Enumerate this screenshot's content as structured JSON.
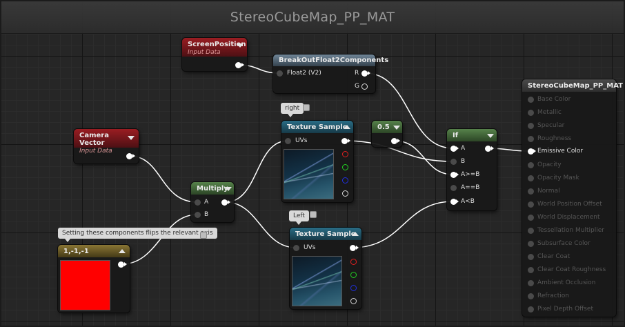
{
  "window": {
    "title": "StereoCubeMap_PP_MAT"
  },
  "nodes": {
    "screen_position": {
      "title": "ScreenPosition",
      "subtitle": "Input Data"
    },
    "camera_vector": {
      "title": "Camera Vector",
      "subtitle": "Input Data"
    },
    "breakout": {
      "title": "BreakOutFloat2Components",
      "inputs": [
        "Float2 (V2)"
      ],
      "outputs": [
        "R",
        "G"
      ]
    },
    "multiply": {
      "title": "Multiply",
      "inputs": [
        "A",
        "B"
      ]
    },
    "constant3": {
      "title": "1,-1,-1",
      "preview_color": "#ff0000"
    },
    "scalar": {
      "title": "0.5"
    },
    "tex_right": {
      "title": "Texture Sample",
      "input": "UVs",
      "comment": "right"
    },
    "tex_left": {
      "title": "Texture Sample",
      "input": "UVs",
      "comment": "Left"
    },
    "if_node": {
      "title": "If",
      "inputs": [
        "A",
        "B",
        "A>=B",
        "A==B",
        "A<B"
      ]
    },
    "material_output": {
      "title": "StereoCubeMap_PP_MAT",
      "inputs": [
        "Base Color",
        "Metallic",
        "Specular",
        "Roughness",
        "Emissive Color",
        "Opacity",
        "Opacity Mask",
        "Normal",
        "World Position Offset",
        "World Displacement",
        "Tessellation Multiplier",
        "Subsurface Color",
        "Clear Coat",
        "Clear Coat Roughness",
        "Ambient Occlusion",
        "Refraction",
        "Pixel Depth Offset"
      ],
      "active_input": "Emissive Color"
    }
  },
  "comments": {
    "constant_note": "Setting these components flips the relevant axis"
  },
  "colors": {
    "input_node": "#9a1d22",
    "function_node": "#6f8597",
    "texture_node": "#2a6d86",
    "math_node": "#56824a",
    "constant_node": "#8a7634",
    "wire": "#ffffff"
  }
}
